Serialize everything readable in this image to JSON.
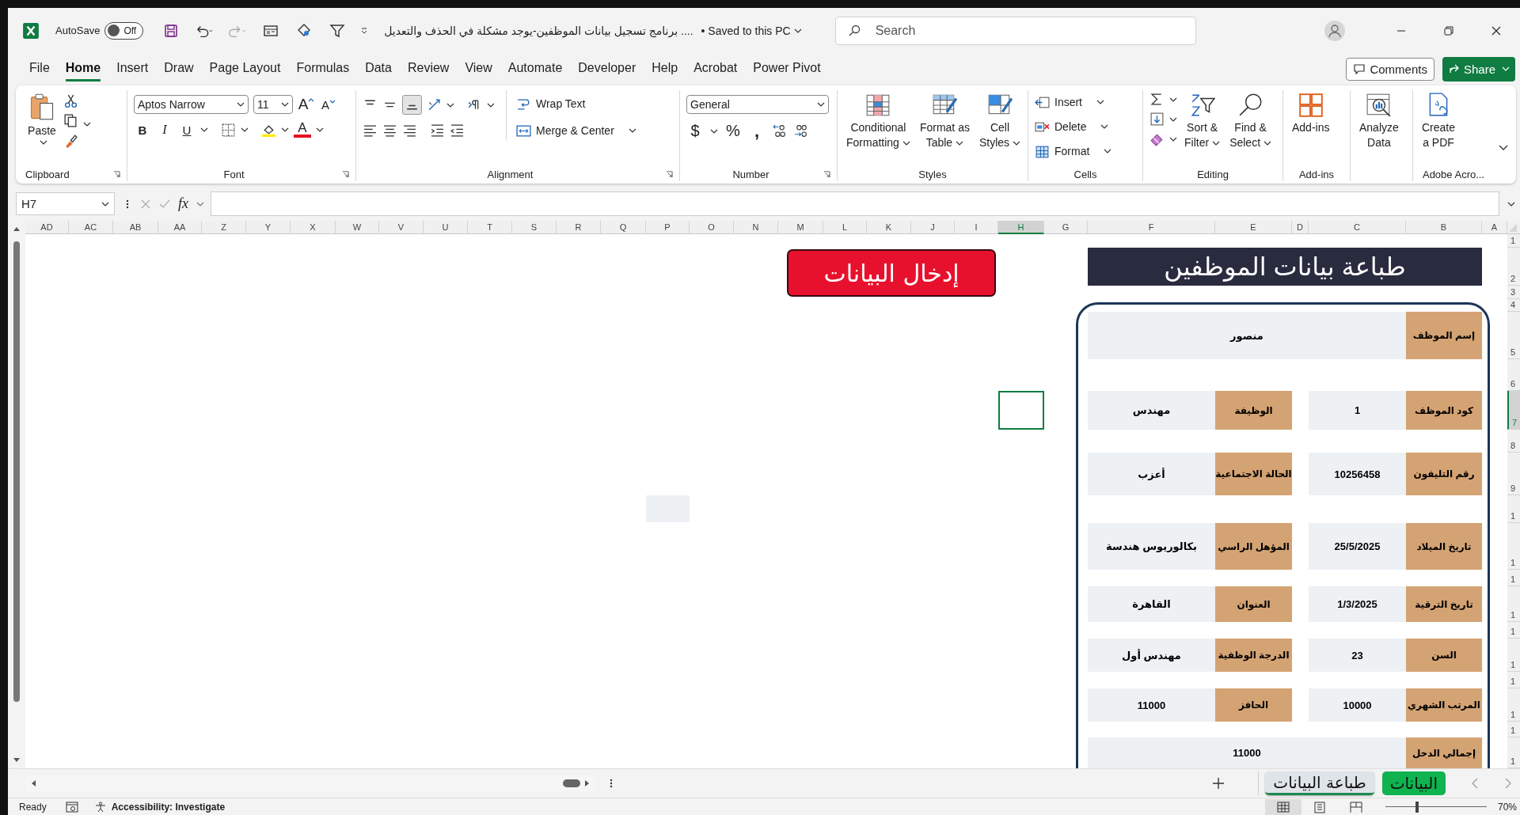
{
  "title_bar": {
    "autosave_label": "AutoSave",
    "autosave_on": false,
    "autosave_state": "Off",
    "document_title": "برنامج تسجيل بيانات الموظفين-يوجد مشكلة في الحذف والتعديل ....",
    "save_status": "• Saved to this PC",
    "search_placeholder": "Search"
  },
  "ribbon_tabs": [
    {
      "label": "File",
      "selected": false
    },
    {
      "label": "Home",
      "selected": true
    },
    {
      "label": "Insert",
      "selected": false
    },
    {
      "label": "Draw",
      "selected": false
    },
    {
      "label": "Page Layout",
      "selected": false
    },
    {
      "label": "Formulas",
      "selected": false
    },
    {
      "label": "Data",
      "selected": false
    },
    {
      "label": "Review",
      "selected": false
    },
    {
      "label": "View",
      "selected": false
    },
    {
      "label": "Automate",
      "selected": false
    },
    {
      "label": "Developer",
      "selected": false
    },
    {
      "label": "Help",
      "selected": false
    },
    {
      "label": "Acrobat",
      "selected": false
    },
    {
      "label": "Power Pivot",
      "selected": false
    }
  ],
  "comments_button": "Comments",
  "share_button": "Share",
  "ribbon": {
    "clipboard": {
      "paste": "Paste",
      "label": "Clipboard"
    },
    "font": {
      "name": "Aptos Narrow",
      "size": "11",
      "grow": "A",
      "shrink": "A",
      "bold": "B",
      "italic": "I",
      "underline": "U",
      "font_color": "A",
      "label": "Font"
    },
    "alignment": {
      "wrap": "Wrap Text",
      "merge": "Merge & Center",
      "label": "Alignment"
    },
    "number": {
      "format": "General",
      "currency": "$",
      "percent": "%",
      "comma": ",",
      "label": "Number"
    },
    "styles": {
      "buttons": [
        {
          "lines": [
            "Conditional",
            "Formatting"
          ],
          "kind": "conditional"
        },
        {
          "lines": [
            "Format as",
            "Table"
          ],
          "kind": "table"
        },
        {
          "lines": [
            "Cell",
            "Styles"
          ],
          "kind": "cellstyles"
        }
      ],
      "label": "Styles"
    },
    "cells": {
      "buttons": [
        {
          "label": "Insert",
          "kind": "insert"
        },
        {
          "label": "Delete",
          "kind": "delete"
        },
        {
          "label": "Format",
          "kind": "format"
        }
      ],
      "label": "Cells"
    },
    "editing": {
      "buttons": [
        {
          "lines": [
            "Sort &",
            "Filter"
          ],
          "kind": "sort"
        },
        {
          "lines": [
            "Find &",
            "Select"
          ],
          "kind": "find"
        }
      ],
      "label": "Editing"
    },
    "addins": {
      "button": "Add-ins",
      "label": "Add-ins"
    },
    "analyze": {
      "lines": [
        "Analyze",
        "Data"
      ]
    },
    "adobe": {
      "lines": [
        "Create",
        "a PDF"
      ],
      "label": "Adobe Acro..."
    }
  },
  "formula_bar": {
    "name_box": "H7",
    "fx": "fx"
  },
  "sheet": {
    "columns": [
      {
        "label": "AD",
        "selected": false
      },
      {
        "label": "AC",
        "selected": false
      },
      {
        "label": "AB",
        "selected": false
      },
      {
        "label": "AA",
        "selected": false
      },
      {
        "label": "Z",
        "selected": false
      },
      {
        "label": "Y",
        "selected": false
      },
      {
        "label": "X",
        "selected": false
      },
      {
        "label": "W",
        "selected": false
      },
      {
        "label": "V",
        "selected": false
      },
      {
        "label": "U",
        "selected": false
      },
      {
        "label": "T",
        "selected": false
      },
      {
        "label": "S",
        "selected": false
      },
      {
        "label": "R",
        "selected": false
      },
      {
        "label": "Q",
        "selected": false
      },
      {
        "label": "P",
        "selected": false
      },
      {
        "label": "O",
        "selected": false
      },
      {
        "label": "N",
        "selected": false
      },
      {
        "label": "M",
        "selected": false
      },
      {
        "label": "L",
        "selected": false
      },
      {
        "label": "K",
        "selected": false
      },
      {
        "label": "J",
        "selected": false
      },
      {
        "label": "I",
        "selected": false
      },
      {
        "label": "H",
        "selected": true
      },
      {
        "label": "G",
        "selected": false
      },
      {
        "label": "F",
        "selected": false
      },
      {
        "label": "E",
        "selected": false
      },
      {
        "label": "D",
        "selected": false
      },
      {
        "label": "C",
        "selected": false
      },
      {
        "label": "B",
        "selected": false
      },
      {
        "label": "A",
        "selected": false
      }
    ],
    "rows": [
      {
        "label": "1",
        "selected": false
      },
      {
        "label": "2",
        "selected": false
      },
      {
        "label": "3",
        "selected": false
      },
      {
        "label": "4",
        "selected": false
      },
      {
        "label": "5",
        "selected": false
      },
      {
        "label": "6",
        "selected": false
      },
      {
        "label": "7",
        "selected": true
      },
      {
        "label": "8",
        "selected": false
      },
      {
        "label": "9",
        "selected": false
      },
      {
        "label": "1",
        "selected": false
      },
      {
        "label": "1",
        "selected": false
      },
      {
        "label": "1",
        "selected": false
      },
      {
        "label": "1",
        "selected": false
      },
      {
        "label": "1",
        "selected": false
      },
      {
        "label": "1",
        "selected": false
      },
      {
        "label": "1",
        "selected": false
      },
      {
        "label": "1",
        "selected": false
      },
      {
        "label": "1",
        "selected": false
      },
      {
        "label": "1",
        "selected": false
      }
    ],
    "entry_button": "إدخال البيانات",
    "form_title": "طباعة بيانات الموظفين",
    "name_row": {
      "label": "إسم الموظف",
      "value": "منصور"
    },
    "pairs": [
      {
        "right_label": "كود الموظف",
        "right_value": "1",
        "left_label": "الوظيفة",
        "left_value": "مهندس"
      },
      {
        "right_label": "رقم التليفون",
        "right_value": "10256458",
        "left_label": "الحالة الاجتماعية",
        "left_value": "أعزب"
      },
      {
        "right_label": "تاريخ الميلاد",
        "right_value": "25/5/2025",
        "left_label": "المؤهل الراسي",
        "left_value": "بكالوريوس هندسة"
      },
      {
        "right_label": "تاريخ الترقية",
        "right_value": "1/3/2025",
        "left_label": "العنوان",
        "left_value": "القاهرة"
      },
      {
        "right_label": "السن",
        "right_value": "23",
        "left_label": "الدرجة الوظفية",
        "left_value": "مهندس أول"
      },
      {
        "right_label": "المرتب الشهري",
        "right_value": "10000",
        "left_label": "الحافز",
        "left_value": "11000"
      }
    ],
    "total_row": {
      "label": "إجمالي الدخل",
      "value": "11000"
    }
  },
  "sheet_tabs": [
    {
      "label": "البيانات",
      "selected": false,
      "color": "#0fb34f"
    },
    {
      "label": "طباعة البيانات",
      "selected": true,
      "color": "#1e8a50"
    }
  ],
  "status_bar": {
    "ready": "Ready",
    "accessibility": "Accessibility: Investigate",
    "zoom_slider": {
      "level": 0.3
    },
    "zoom": "70%"
  }
}
